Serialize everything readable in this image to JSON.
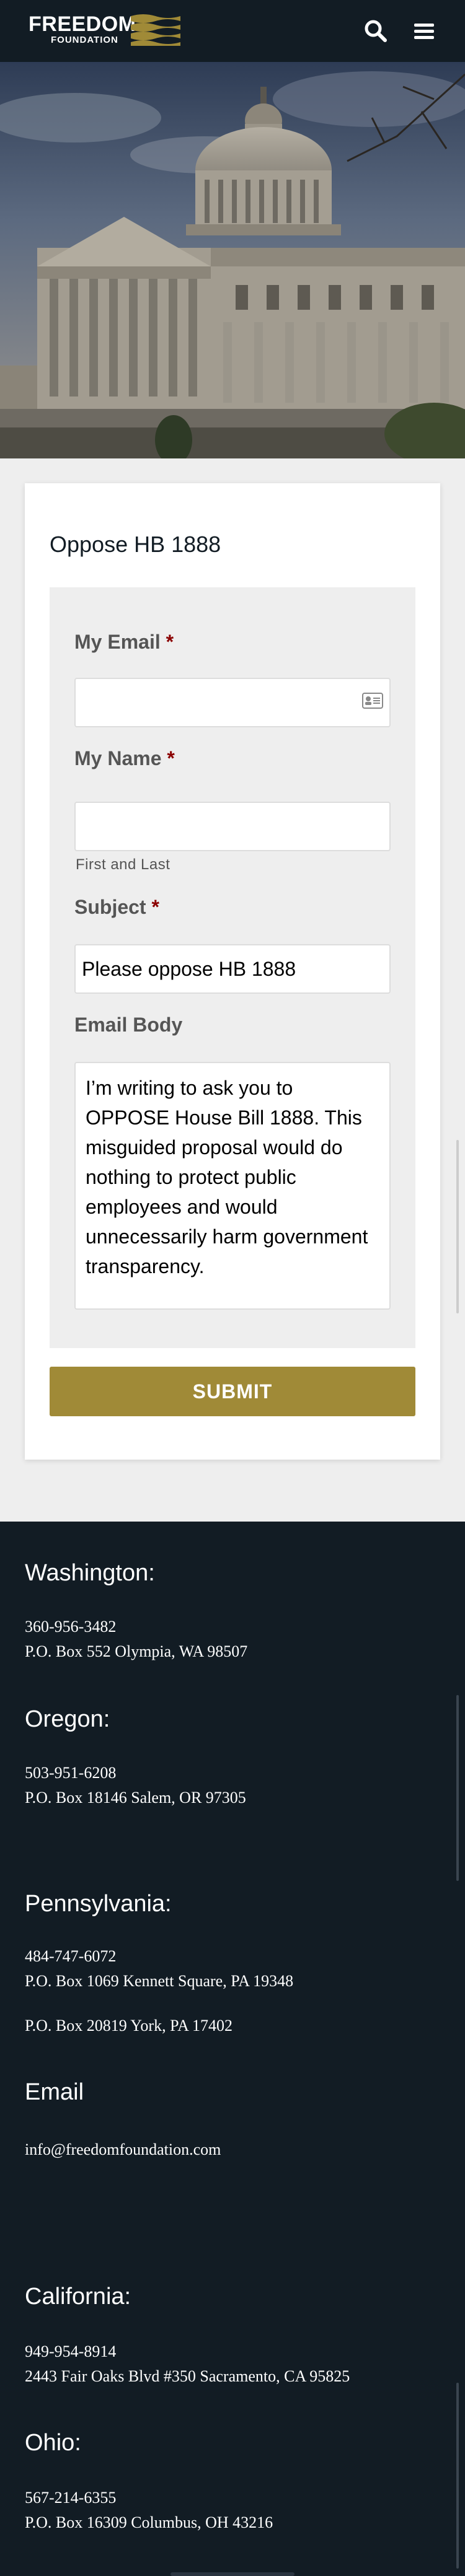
{
  "header": {
    "logo_word1": "FREEDOM",
    "logo_word2": "FOUNDATION",
    "search_icon": "search-icon",
    "menu_icon": "hamburger-menu-icon",
    "logo_accent_color": "#a08a37"
  },
  "form": {
    "title": "Oppose HB 1888",
    "email_label": "My Email",
    "name_label": "My Name",
    "name_helper": "First and Last",
    "subject_label": "Subject",
    "subject_value": "Please oppose HB 1888",
    "body_label": "Email Body",
    "body_value": "I’m writing to ask you to OPPOSE House Bill 1888. This misguided proposal would do nothing to protect public employees and would unnecessarily harm government transparency.",
    "required_mark": "*",
    "submit_label": "SUBMIT",
    "submit_color": "#a08a37"
  },
  "footer": {
    "washington": {
      "heading": "Washington:",
      "phone": "360-956-3482",
      "address": "P.O. Box 552 Olympia, WA 98507"
    },
    "oregon": {
      "heading": "Oregon:",
      "phone": "503-951-6208",
      "address": "P.O. Box 18146 Salem, OR 97305"
    },
    "pennsylvania": {
      "heading": "Pennsylvania:",
      "phone": "484-747-6072",
      "address": "P.O. Box 1069 Kennett Square, PA 19348",
      "address2": "P.O. Box 20819 York, PA 17402"
    },
    "email": {
      "heading": "Email",
      "address": "info@freedomfoundation.com"
    },
    "california": {
      "heading": "California:",
      "phone": "949-954-8914",
      "address": "2443 Fair Oaks Blvd #350 Sacramento, CA 95825"
    },
    "ohio": {
      "heading": "Ohio:",
      "phone": "567-214-6355",
      "address": "P.O. Box 16309 Columbus, OH 43216"
    }
  }
}
